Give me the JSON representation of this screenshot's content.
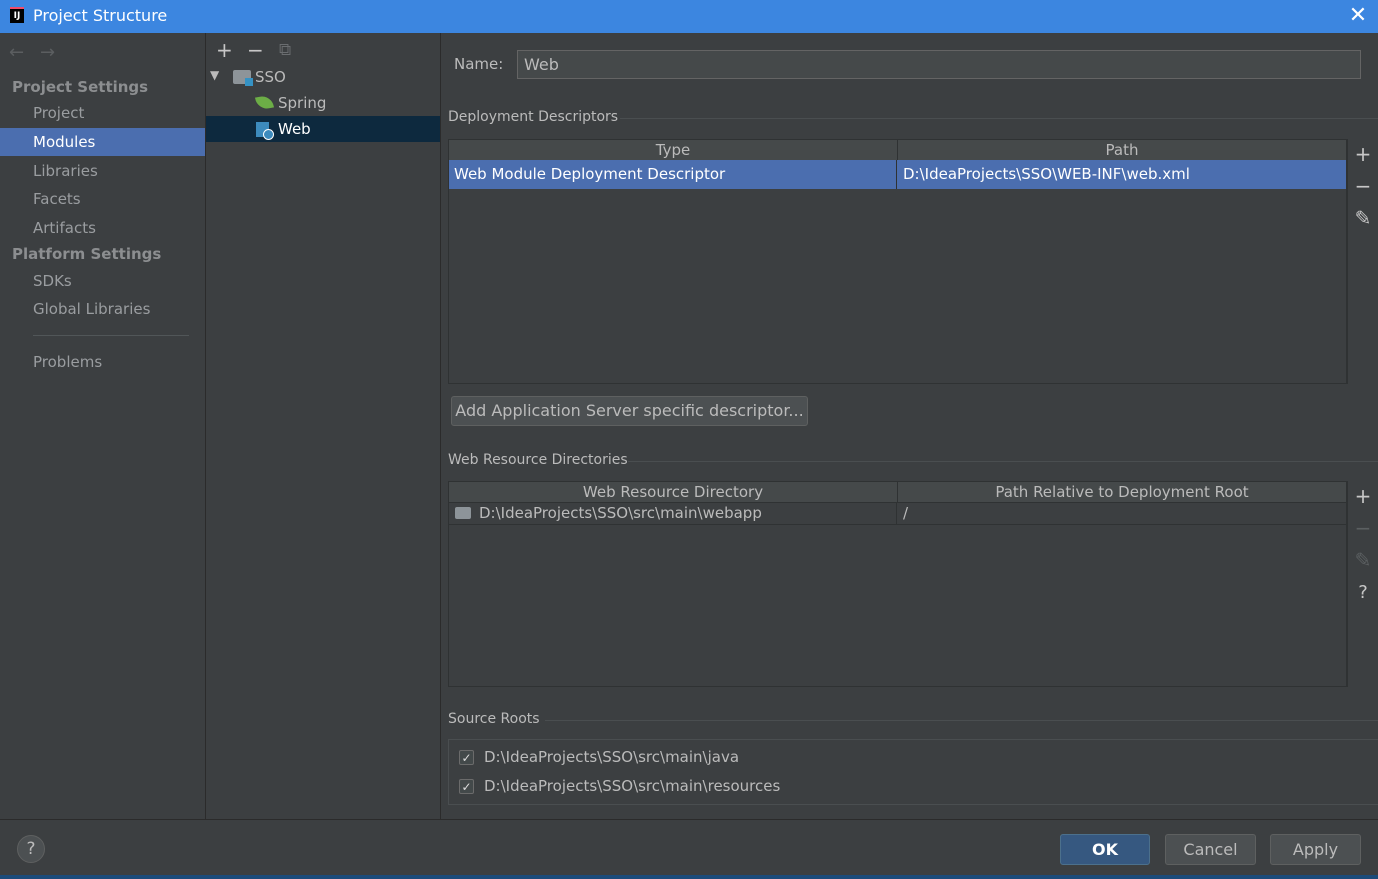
{
  "window": {
    "title": "Project Structure",
    "logo_text": "IJ"
  },
  "nav": {
    "back_glyph": "←",
    "forward_glyph": "→",
    "project_settings_header": "Project Settings",
    "platform_settings_header": "Platform Settings",
    "items": [
      {
        "label": "Project"
      },
      {
        "label": "Modules"
      },
      {
        "label": "Libraries"
      },
      {
        "label": "Facets"
      },
      {
        "label": "Artifacts"
      },
      {
        "label": "SDKs"
      },
      {
        "label": "Global Libraries"
      },
      {
        "label": "Problems"
      }
    ],
    "selected": "Modules"
  },
  "tree": {
    "toolbar": {
      "add_glyph": "+",
      "remove_glyph": "−",
      "copy_glyph": "⧉"
    },
    "root": {
      "label": "SSO",
      "expanded": true
    },
    "children": [
      {
        "label": "Spring",
        "icon": "spring-icon"
      },
      {
        "label": "Web",
        "icon": "web-facet-icon",
        "selected": true
      }
    ]
  },
  "details": {
    "name_label": "Name:",
    "name_value": "Web",
    "deployment": {
      "title": "Deployment Descriptors",
      "columns": [
        "Type",
        "Path"
      ],
      "rows": [
        {
          "type": "Web Module Deployment Descriptor",
          "path": "D:\\IdeaProjects\\SSO\\WEB-INF\\web.xml"
        }
      ],
      "add_server_button": "Add Application Server specific descriptor..."
    },
    "web_resources": {
      "title": "Web Resource Directories",
      "columns": [
        "Web Resource Directory",
        "Path Relative to Deployment Root"
      ],
      "rows": [
        {
          "directory": "D:\\IdeaProjects\\SSO\\src\\main\\webapp",
          "relative": "/"
        }
      ],
      "help_glyph": "?"
    },
    "source_roots": {
      "title": "Source Roots",
      "items": [
        {
          "path": "D:\\IdeaProjects\\SSO\\src\\main\\java",
          "checked": true
        },
        {
          "path": "D:\\IdeaProjects\\SSO\\src\\main\\resources",
          "checked": true
        }
      ]
    },
    "side_glyphs": {
      "add": "+",
      "remove": "−",
      "edit": "✎",
      "check": "✓"
    }
  },
  "footer": {
    "help": "?",
    "ok": "OK",
    "cancel": "Cancel",
    "apply": "Apply"
  },
  "colors": {
    "titlebar": "#3c86e0",
    "background": "#3c3f41",
    "selection": "#4b6eaf",
    "tree_selection": "#0d293e",
    "primary_button": "#365880"
  }
}
